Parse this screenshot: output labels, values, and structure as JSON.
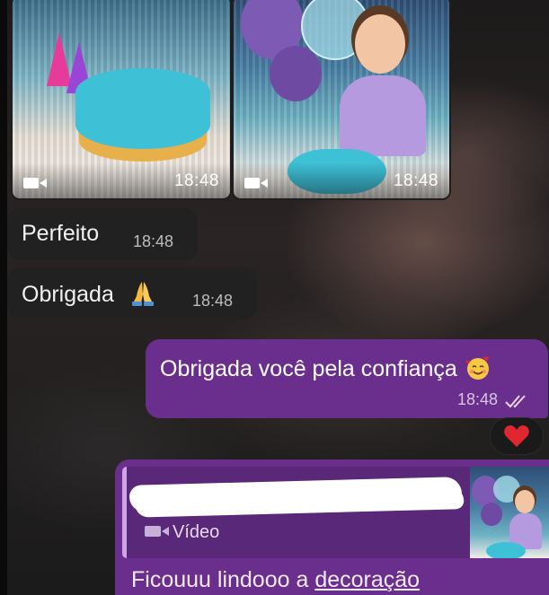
{
  "media": [
    {
      "time": "18:48",
      "icon": "video-icon"
    },
    {
      "time": "18:48",
      "icon": "video-icon"
    }
  ],
  "messages_in": [
    {
      "text": "Perfeito",
      "time": "18:48"
    },
    {
      "text": "Obrigada",
      "time": "18:48",
      "emoji": "folded-hands-icon"
    }
  ],
  "message_out": {
    "text": "Obrigada você pela confiança",
    "emoji": "smiling-face-with-hearts-icon",
    "time": "18:48",
    "status": "double-check-icon"
  },
  "reaction": {
    "emoji": "heart-icon",
    "color": "#e0262f"
  },
  "reply": {
    "quoted_label": "Vídeo",
    "text_prefix": "Ficouuu lindooo a ",
    "text_underlined": "decoração"
  },
  "colors": {
    "outgoing_bubble": "#6a2f8c",
    "incoming_bubble": "#212121",
    "quote_bar": "#d0a4ea"
  }
}
